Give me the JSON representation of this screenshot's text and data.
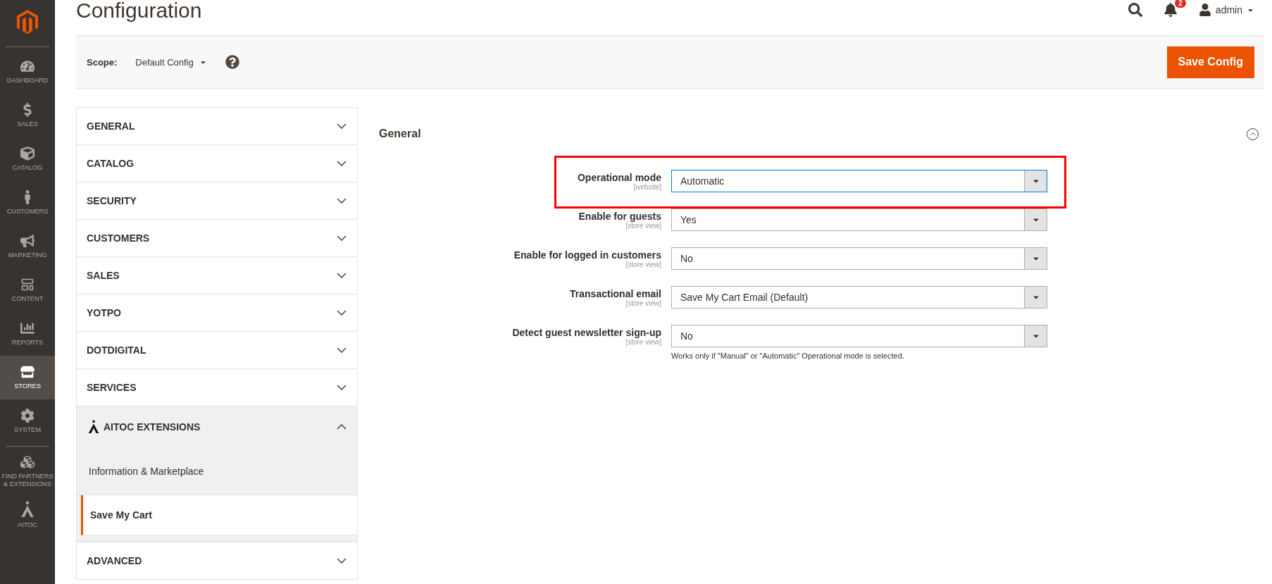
{
  "sidebar": {
    "items": [
      {
        "label": "DASHBOARD",
        "selected": false
      },
      {
        "label": "SALES",
        "selected": false
      },
      {
        "label": "CATALOG",
        "selected": false
      },
      {
        "label": "CUSTOMERS",
        "selected": false
      },
      {
        "label": "MARKETING",
        "selected": false
      },
      {
        "label": "CONTENT",
        "selected": false
      },
      {
        "label": "REPORTS",
        "selected": false
      },
      {
        "label": "STORES",
        "selected": true
      },
      {
        "label": "SYSTEM",
        "selected": false
      },
      {
        "label": "FIND PARTNERS & EXTENSIONS",
        "selected": false,
        "divider_before": true
      },
      {
        "label": "AITOC",
        "selected": false
      }
    ]
  },
  "header": {
    "title": "Configuration",
    "notifications": "2",
    "user": "admin"
  },
  "scope": {
    "label": "Scope:",
    "value": "Default Config"
  },
  "save_button": "Save Config",
  "nav": {
    "sections": [
      {
        "label": "GENERAL",
        "expanded": false
      },
      {
        "label": "CATALOG",
        "expanded": false
      },
      {
        "label": "SECURITY",
        "expanded": false
      },
      {
        "label": "CUSTOMERS",
        "expanded": false
      },
      {
        "label": "SALES",
        "expanded": false
      },
      {
        "label": "YOTPO",
        "expanded": false
      },
      {
        "label": "DOTDIGITAL",
        "expanded": false
      },
      {
        "label": "SERVICES",
        "expanded": false
      },
      {
        "label": "AITOC EXTENSIONS",
        "expanded": true,
        "has_logo": true,
        "children": [
          {
            "label": "Information & Marketplace",
            "selected": false
          },
          {
            "label": "Save My Cart",
            "selected": true
          }
        ]
      },
      {
        "label": "ADVANCED",
        "expanded": false
      }
    ]
  },
  "section": {
    "title": "General",
    "expanded": true,
    "fields": [
      {
        "label": "Operational mode",
        "scope": "[website]",
        "value": "Automatic",
        "highlighted": true,
        "focused": true
      },
      {
        "label": "Enable for guests",
        "scope": "[store view]",
        "value": "Yes",
        "highlighted": false,
        "focused": false
      },
      {
        "label": "Enable for logged in customers",
        "scope": "[store view]",
        "value": "No",
        "highlighted": false,
        "focused": false
      },
      {
        "label": "Transactional email",
        "scope": "[store view]",
        "value": "Save My Cart Email (Default)",
        "highlighted": false,
        "focused": false
      },
      {
        "label": "Detect guest newsletter sign-up",
        "scope": "[store view]",
        "value": "No",
        "highlighted": false,
        "focused": false,
        "note": "Works only if \"Manual\" or \"Automatic\" Operational mode is selected."
      }
    ]
  }
}
